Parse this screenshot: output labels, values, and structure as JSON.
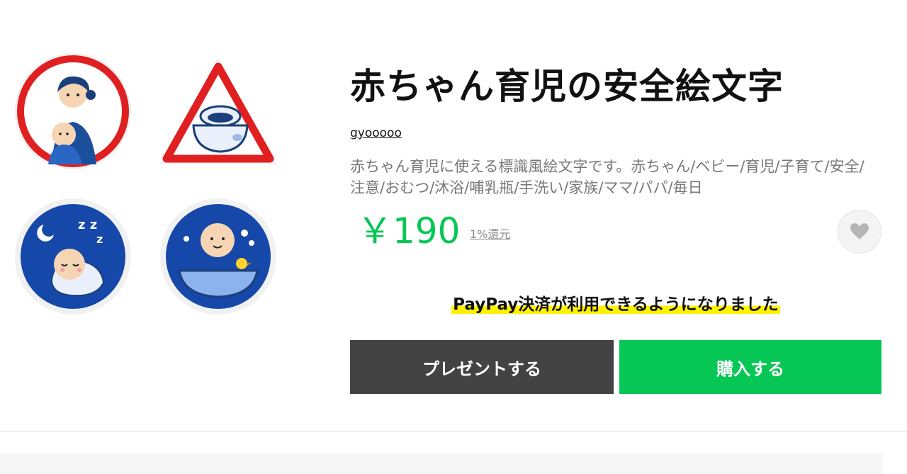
{
  "product": {
    "title": "赤ちゃん育児の安全絵文字",
    "author": "gyooooo",
    "description": "赤ちゃん育児に使える標識風絵文字です。赤ちゃん/ベビー/育児/子育て/安全/注意/おむつ/沐浴/哺乳瓶/手洗い/家族/ママ/パパ/毎日",
    "price": "￥190",
    "cashback": "1%還元"
  },
  "notice": {
    "paypay": "PayPay決済が利用できるようになりました"
  },
  "buttons": {
    "present": "プレゼントする",
    "buy": "購入する"
  },
  "preview_icons": [
    "mother-holding-baby-sign-icon",
    "potty-warning-sign-icon",
    "sleeping-baby-sign-icon",
    "baby-bath-sign-icon"
  ],
  "colors": {
    "price": "#06c755",
    "buy_button": "#06c755",
    "present_button": "#434343",
    "highlight": "#fff200"
  }
}
